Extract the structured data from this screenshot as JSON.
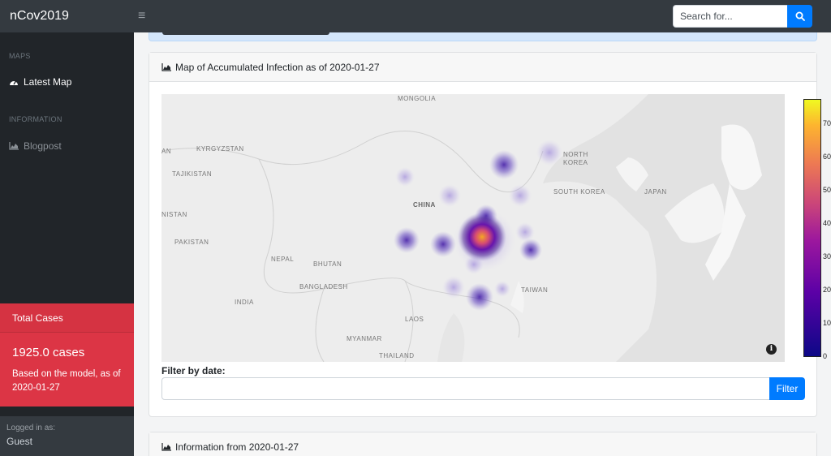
{
  "app": {
    "brand": "nCov2019",
    "menu_toggle": "≡"
  },
  "search": {
    "placeholder": "Search for..."
  },
  "sidebar": {
    "sections": [
      {
        "heading": "MAPS",
        "items": [
          {
            "label": "Latest Map",
            "icon": "dashboard-icon",
            "active": true
          }
        ]
      },
      {
        "heading": "INFORMATION",
        "items": [
          {
            "label": "Blogpost",
            "icon": "area-chart-icon",
            "active": false
          }
        ]
      }
    ],
    "total": {
      "header": "Total Cases",
      "value": "1925.0 cases",
      "note": "Based on the model, as of 2020-01-27"
    },
    "footer": {
      "label": "Logged in as:",
      "user": "Guest"
    }
  },
  "map_card": {
    "title": "Map of Accumulated Infection as of 2020-01-27",
    "map_labels": [
      "MONGOLIA",
      "KYRGYZSTAN",
      "TAJIKISTAN",
      "NORTH KOREA",
      "SOUTH KOREA",
      "JAPAN",
      "CHINA",
      "NISTAN",
      "PAKISTAN",
      "NEPAL",
      "BHUTAN",
      "BANGLADESH",
      "INDIA",
      "TAIWAN",
      "LAOS",
      "MYANMAR",
      "THAILAND",
      "AN"
    ],
    "colorbar_ticks": [
      "70",
      "60",
      "50",
      "40",
      "30",
      "20",
      "10",
      "0"
    ],
    "filter_label": "Filter by date:",
    "filter_value": "",
    "filter_button": "Filter"
  },
  "info_card": {
    "title": "Information from 2020-01-27"
  },
  "colors": {
    "accent": "#007bff",
    "danger": "#dc3545",
    "navbar": "#343a40",
    "sidebar": "#212529"
  }
}
